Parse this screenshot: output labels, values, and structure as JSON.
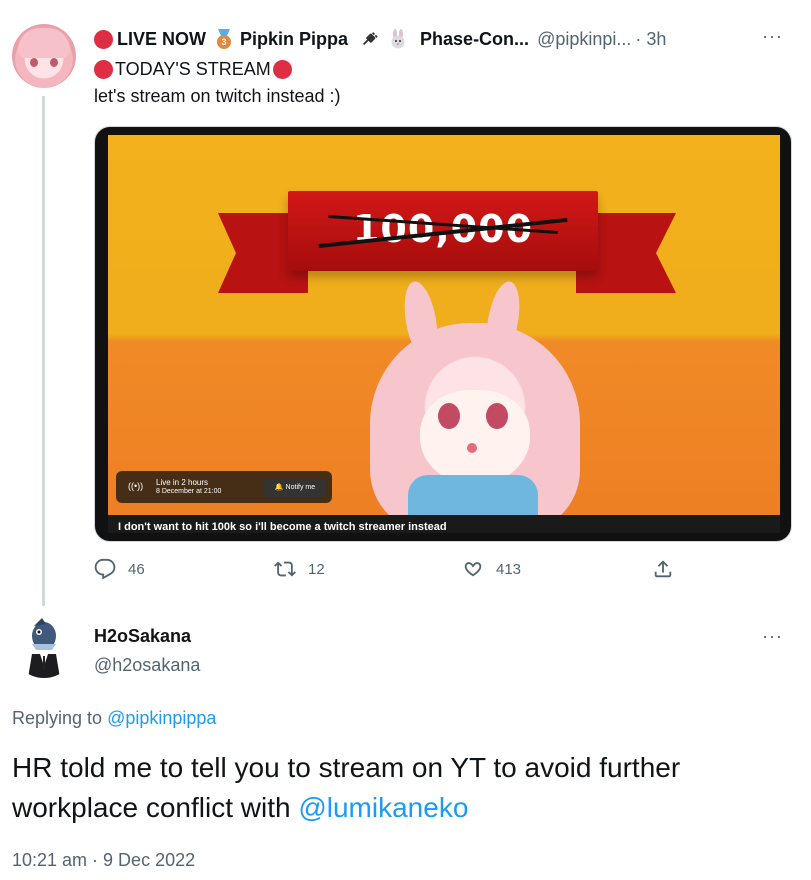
{
  "parent_tweet": {
    "name_prefix": "LIVE NOW",
    "medal_number": "3",
    "display_name": "Pipkin Pippa",
    "name_suffix": "Phase-Con...",
    "handle": "@pipkinpi...",
    "time": "· 3h",
    "more": "···",
    "line1": "TODAY'S STREAM",
    "line2": "let's stream on twitch instead :)",
    "media": {
      "banner_text": "100,000",
      "live_label": "Live in 2 hours",
      "live_date": "8 December at 21:00",
      "notify_label": "Notify me",
      "caption": "I don't want to hit 100k so i'll become a twitch streamer instead"
    },
    "actions": {
      "replies": "46",
      "retweets": "12",
      "likes": "413"
    },
    "icons": [
      "red-circle-icon",
      "bronze-medal-icon",
      "plug-icon",
      "rabbit-icon",
      "reply-icon",
      "retweet-icon",
      "like-icon",
      "share-icon"
    ]
  },
  "reply_tweet": {
    "display_name": "H2oSakana",
    "handle": "@h2osakana",
    "more": "···",
    "replying_to_prefix": "Replying to",
    "replying_to_handle": "@pipkinpippa",
    "text_main": "HR told me to tell you to stream on YT to avoid further workplace conflict with ",
    "text_mention": "@lumikaneko",
    "timestamp": "10:21 am · 9 Dec 2022"
  },
  "colors": {
    "link": "#1d9bf0",
    "secondary_text": "#536471",
    "red_dot": "#dd2e44"
  }
}
